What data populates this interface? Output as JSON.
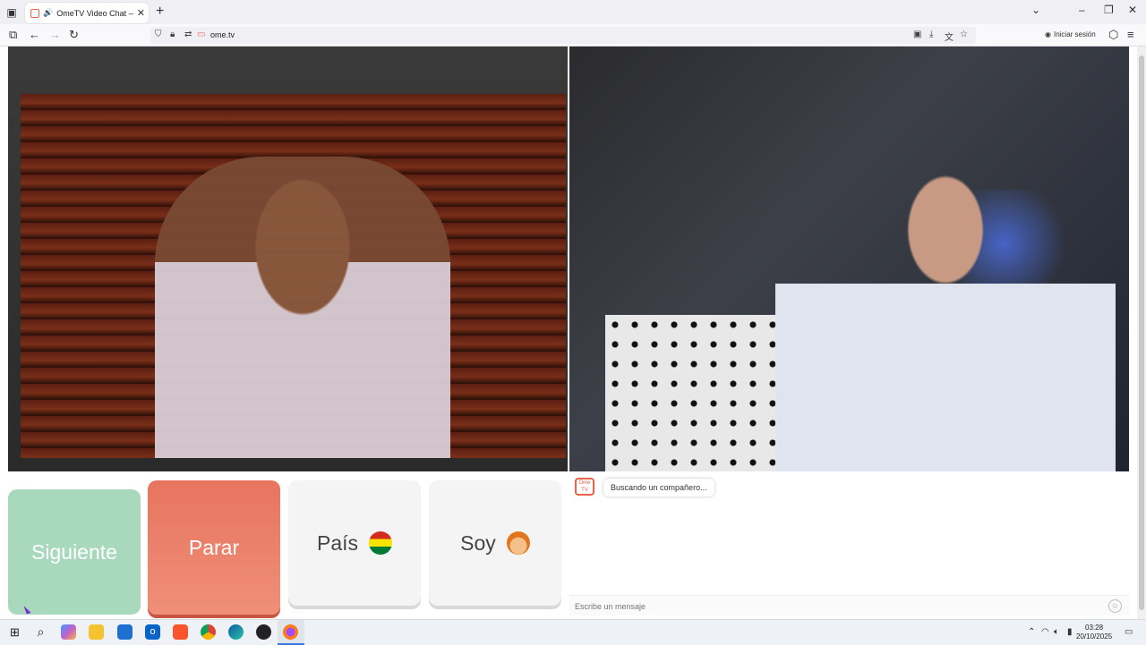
{
  "browser": {
    "tab_title": "OmeTV Video Chat — Ome",
    "url": "ome.tv",
    "signin_label": "Iniciar sesión"
  },
  "controls": {
    "next_label": "Siguiente",
    "stop_label": "Parar",
    "country_label": "País",
    "gender_label": "Soy"
  },
  "chat": {
    "logo_text": "Ome TV",
    "status_message": "Buscando un compañero...",
    "input_placeholder": "Escribe un mensaje"
  },
  "taskbar": {
    "time": "03:28",
    "date": "20/10/2025"
  },
  "colors": {
    "next_button": "#a8d9bd",
    "stop_button": "#e7745e",
    "brand_orange": "#e8634a"
  }
}
